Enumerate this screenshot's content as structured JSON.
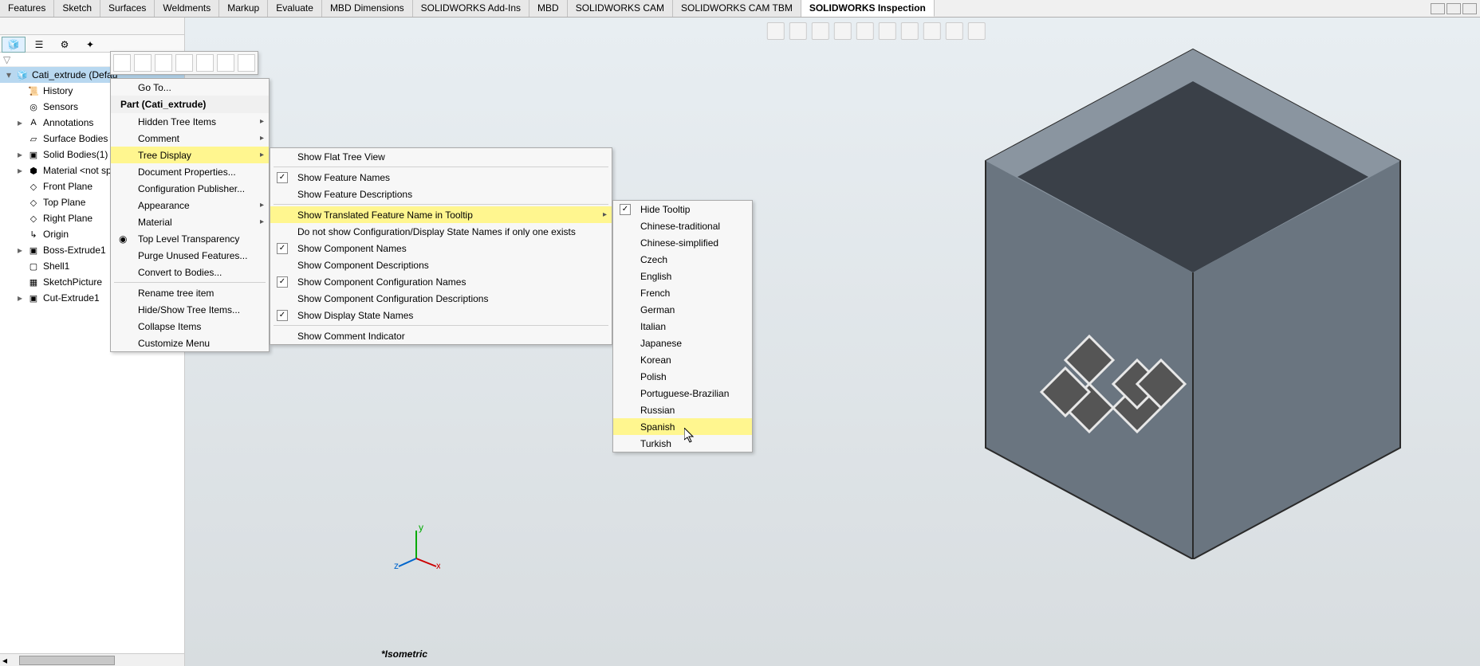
{
  "tabs": {
    "items": [
      "Features",
      "Sketch",
      "Surfaces",
      "Weldments",
      "Markup",
      "Evaluate",
      "MBD Dimensions",
      "SOLIDWORKS Add-Ins",
      "MBD",
      "SOLIDWORKS CAM",
      "SOLIDWORKS CAM TBM",
      "SOLIDWORKS Inspection"
    ],
    "active_index": 11
  },
  "tree": {
    "root": "Cati_extrude (Defau",
    "items": [
      {
        "label": "History",
        "icon": "📜"
      },
      {
        "label": "Sensors",
        "icon": "◎"
      },
      {
        "label": "Annotations",
        "icon": "A",
        "exp": "▸"
      },
      {
        "label": "Surface Bodies",
        "icon": "▱"
      },
      {
        "label": "Solid Bodies(1)",
        "icon": "▣",
        "exp": "▸"
      },
      {
        "label": "Material <not sp",
        "icon": "⬢",
        "exp": "▸"
      },
      {
        "label": "Front Plane",
        "icon": "◇"
      },
      {
        "label": "Top Plane",
        "icon": "◇"
      },
      {
        "label": "Right Plane",
        "icon": "◇"
      },
      {
        "label": "Origin",
        "icon": "↳"
      },
      {
        "label": "Boss-Extrude1",
        "icon": "▣",
        "exp": "▸"
      },
      {
        "label": "Shell1",
        "icon": "▢"
      },
      {
        "label": "SketchPicture",
        "icon": "▦"
      },
      {
        "label": "Cut-Extrude1",
        "icon": "▣",
        "exp": "▸"
      }
    ]
  },
  "menu1": {
    "go_to": "Go To...",
    "title": "Part (Cati_extrude)",
    "items": [
      {
        "label": "Hidden Tree Items",
        "sub": true
      },
      {
        "label": "Comment",
        "sub": true
      },
      {
        "label": "Tree Display",
        "sub": true,
        "hl": true
      },
      {
        "label": "Document Properties..."
      },
      {
        "label": "Configuration Publisher..."
      },
      {
        "label": "Appearance",
        "sub": true
      },
      {
        "label": "Material",
        "sub": true
      },
      {
        "label": "Top Level Transparency",
        "icon": "◉"
      },
      {
        "label": "Purge Unused Features..."
      },
      {
        "label": "Convert to Bodies..."
      },
      {
        "label": "Rename tree item"
      },
      {
        "label": "Hide/Show Tree Items..."
      },
      {
        "label": "Collapse Items"
      },
      {
        "label": "Customize Menu"
      }
    ],
    "underlines": {
      "0": "",
      "2": "T",
      "3": "D",
      "4": "",
      "5": "",
      "6": "M",
      "8": "",
      "9": "o",
      "10": "",
      "12": "",
      "13": "M"
    }
  },
  "menu2": {
    "items": [
      {
        "label": "Show Flat Tree View"
      },
      {
        "label": "Show Feature Names",
        "chk": true
      },
      {
        "label": "Show Feature Descriptions"
      },
      {
        "label": "Show Translated Feature Name in Tooltip",
        "sub": true,
        "hl": true
      },
      {
        "label": "Do not show Configuration/Display State Names if only one exists"
      },
      {
        "label": "Show Component Names",
        "chk": true
      },
      {
        "label": "Show Component Descriptions"
      },
      {
        "label": "Show Component Configuration Names",
        "chk": true
      },
      {
        "label": "Show Component Configuration Descriptions"
      },
      {
        "label": "Show Display State Names",
        "chk": true
      },
      {
        "label": "Show Comment Indicator"
      }
    ]
  },
  "menu3": {
    "items": [
      {
        "label": "Hide Tooltip",
        "chk": true
      },
      {
        "label": "Chinese-traditional"
      },
      {
        "label": "Chinese-simplified"
      },
      {
        "label": "Czech"
      },
      {
        "label": "English"
      },
      {
        "label": "French"
      },
      {
        "label": "German"
      },
      {
        "label": "Italian"
      },
      {
        "label": "Japanese"
      },
      {
        "label": "Korean"
      },
      {
        "label": "Polish"
      },
      {
        "label": "Portuguese-Brazilian"
      },
      {
        "label": "Russian"
      },
      {
        "label": "Spanish",
        "hl": true
      },
      {
        "label": "Turkish"
      }
    ]
  },
  "view_label": "*Isometric",
  "triad": {
    "x": "x",
    "y": "y",
    "z": "z"
  }
}
